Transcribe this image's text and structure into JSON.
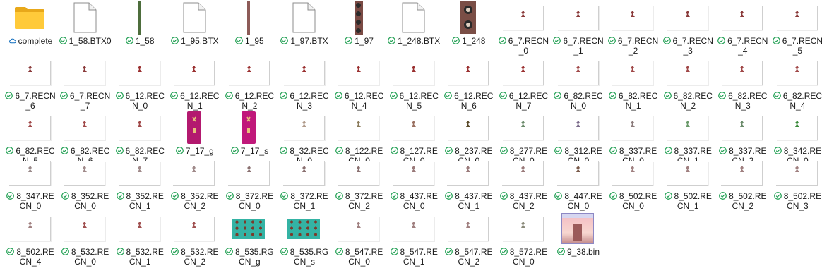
{
  "colors": {
    "sync_green": "#1d9e50",
    "cloud_blue": "#0f6cbd",
    "folder": "#ffca3a",
    "hover": "#e5f3ff"
  },
  "items": [
    {
      "label": "complete",
      "kind": "folder",
      "status": "cloud"
    },
    {
      "label": "1_58.BTX0",
      "kind": "doc",
      "status": "ok"
    },
    {
      "label": "1_58",
      "kind": "strip",
      "status": "ok",
      "color": "#4d6d3c"
    },
    {
      "label": "1_95.BTX",
      "kind": "doc",
      "status": "ok"
    },
    {
      "label": "1_95",
      "kind": "strip",
      "status": "ok",
      "color": "#8d5b58"
    },
    {
      "label": "1_97.BTX",
      "kind": "doc",
      "status": "ok"
    },
    {
      "label": "1_97",
      "kind": "stripwide",
      "status": "ok"
    },
    {
      "label": "1_248.BTX",
      "kind": "doc",
      "status": "ok"
    },
    {
      "label": "1_248",
      "kind": "portrait",
      "status": "ok"
    },
    {
      "label": "6_7.RECN_0",
      "kind": "sprite",
      "status": "ok",
      "color": "#8a3a3a"
    },
    {
      "label": "6_7.RECN_1",
      "kind": "sprite",
      "status": "ok",
      "color": "#8a3a3a"
    },
    {
      "label": "6_7.RECN_2",
      "kind": "sprite",
      "status": "ok",
      "color": "#8a3a3a"
    },
    {
      "label": "6_7.RECN_3",
      "kind": "sprite",
      "status": "ok",
      "color": "#8a3a3a"
    },
    {
      "label": "6_7.RECN_4",
      "kind": "sprite",
      "status": "ok",
      "color": "#8a3a3a"
    },
    {
      "label": "6_7.RECN_5",
      "kind": "sprite",
      "status": "ok",
      "color": "#8a3a3a"
    },
    {
      "label": "6_7.RECN_6",
      "kind": "sprite",
      "status": "ok",
      "color": "#8a3a3a"
    },
    {
      "label": "6_7.RECN_7",
      "kind": "sprite",
      "status": "ok",
      "color": "#8a3a3a"
    },
    {
      "label": "6_12.RECN_0",
      "kind": "sprite",
      "status": "ok",
      "color": "#9a3030"
    },
    {
      "label": "6_12.RECN_1",
      "kind": "sprite",
      "status": "ok",
      "color": "#9a3030"
    },
    {
      "label": "6_12.RECN_2",
      "kind": "sprite",
      "status": "ok",
      "color": "#9a3030"
    },
    {
      "label": "6_12.RECN_3",
      "kind": "sprite",
      "status": "ok",
      "color": "#9a3030"
    },
    {
      "label": "6_12.RECN_4",
      "kind": "sprite",
      "status": "ok",
      "color": "#9a3030"
    },
    {
      "label": "6_12.RECN_5",
      "kind": "sprite",
      "status": "ok",
      "color": "#9a3030"
    },
    {
      "label": "6_12.RECN_6",
      "kind": "sprite",
      "status": "ok",
      "color": "#9a3030"
    },
    {
      "label": "6_12.RECN_7",
      "kind": "sprite",
      "status": "ok",
      "color": "#9a3030"
    },
    {
      "label": "6_82.RECN_0",
      "kind": "sprite",
      "status": "ok",
      "color": "#a04848"
    },
    {
      "label": "6_82.RECN_1",
      "kind": "sprite",
      "status": "ok",
      "color": "#a04848"
    },
    {
      "label": "6_82.RECN_2",
      "kind": "sprite",
      "status": "ok",
      "color": "#a04848"
    },
    {
      "label": "6_82.RECN_3",
      "kind": "sprite",
      "status": "ok",
      "color": "#a04848"
    },
    {
      "label": "6_82.RECN_4",
      "kind": "sprite",
      "status": "ok",
      "color": "#a04848"
    },
    {
      "label": "6_82.RECN_5",
      "kind": "sprite",
      "status": "ok",
      "color": "#a04848"
    },
    {
      "label": "6_82.RECN_6",
      "kind": "sprite",
      "status": "ok",
      "color": "#a04848"
    },
    {
      "label": "6_82.RECN_7",
      "kind": "sprite",
      "status": "ok",
      "color": "#a04848"
    },
    {
      "label": "7_17_g",
      "kind": "tall",
      "status": "ok",
      "color": "#b3196f"
    },
    {
      "label": "7_17_s",
      "kind": "tall",
      "status": "ok",
      "color": "#c0187a"
    },
    {
      "label": "8_32.RECN_0",
      "kind": "sprite",
      "status": "ok",
      "color": "#b09a8a"
    },
    {
      "label": "8_122.RECN_0",
      "kind": "sprite",
      "status": "ok",
      "color": "#8a7a5a"
    },
    {
      "label": "8_127.RECN_0",
      "kind": "sprite",
      "status": "ok",
      "color": "#9a7060"
    },
    {
      "label": "8_237.RECN_0",
      "kind": "sprite",
      "status": "ok",
      "color": "#5a4a2a"
    },
    {
      "label": "8_277.RECN_0",
      "kind": "sprite",
      "status": "ok",
      "color": "#6a8a6a"
    },
    {
      "label": "8_312.RECN_0",
      "kind": "sprite",
      "status": "ok",
      "color": "#7a6a8a"
    },
    {
      "label": "8_337.RECN_0",
      "kind": "sprite",
      "status": "ok",
      "color": "#8a7a7a"
    },
    {
      "label": "8_337.RECN_1",
      "kind": "sprite",
      "status": "ok",
      "color": "#6a9a6a"
    },
    {
      "label": "8_337.RECN_2",
      "kind": "sprite",
      "status": "ok",
      "color": "#6a8a6a"
    },
    {
      "label": "8_342.RECN_0",
      "kind": "sprite",
      "status": "ok",
      "color": "#3a8a3a"
    },
    {
      "label": "8_347.RECN_0",
      "kind": "sprite",
      "status": "ok",
      "color": "#9a8a8a"
    },
    {
      "label": "8_352.RECN_0",
      "kind": "sprite",
      "status": "ok",
      "color": "#a08a8a"
    },
    {
      "label": "8_352.RECN_1",
      "kind": "sprite",
      "status": "ok",
      "color": "#a08a8a"
    },
    {
      "label": "8_352.RECN_2",
      "kind": "sprite",
      "status": "ok",
      "color": "#a08a8a"
    },
    {
      "label": "8_372.RECN_0",
      "kind": "sprite",
      "status": "ok",
      "color": "#8a7070"
    },
    {
      "label": "8_372.RECN_1",
      "kind": "sprite",
      "status": "ok",
      "color": "#8a7070"
    },
    {
      "label": "8_372.RECN_2",
      "kind": "sprite",
      "status": "ok",
      "color": "#8a7070"
    },
    {
      "label": "8_437.RECN_0",
      "kind": "sprite",
      "status": "ok",
      "color": "#9a7a7a"
    },
    {
      "label": "8_437.RECN_1",
      "kind": "sprite",
      "status": "ok",
      "color": "#9a7a7a"
    },
    {
      "label": "8_437.RECN_2",
      "kind": "sprite",
      "status": "ok",
      "color": "#9a7a7a"
    },
    {
      "label": "8_447.RECN_0",
      "kind": "sprite",
      "status": "ok",
      "color": "#7a5a4a"
    },
    {
      "label": "8_502.RECN_0",
      "kind": "sprite",
      "status": "ok",
      "color": "#a08080"
    },
    {
      "label": "8_502.RECN_1",
      "kind": "sprite",
      "status": "ok",
      "color": "#a08080"
    },
    {
      "label": "8_502.RECN_2",
      "kind": "sprite",
      "status": "ok",
      "color": "#a08080"
    },
    {
      "label": "8_502.RECN_3",
      "kind": "sprite",
      "status": "ok",
      "color": "#a08080"
    },
    {
      "label": "8_502.RECN_4",
      "kind": "sprite",
      "status": "ok",
      "color": "#a08080"
    },
    {
      "label": "8_532.RECN_0",
      "kind": "sprite",
      "status": "ok",
      "color": "#a05050"
    },
    {
      "label": "8_532.RECN_1",
      "kind": "sprite",
      "status": "ok",
      "color": "#a05050"
    },
    {
      "label": "8_532.RECN_2",
      "kind": "sprite",
      "status": "ok",
      "color": "#a05050"
    },
    {
      "label": "8_535.RGCN_g",
      "kind": "green",
      "status": "ok"
    },
    {
      "label": "8_535.RGCN_s",
      "kind": "green",
      "status": "ok"
    },
    {
      "label": "8_547.RECN_0",
      "kind": "sprite",
      "status": "ok",
      "color": "#a08080"
    },
    {
      "label": "8_547.RECN_1",
      "kind": "sprite",
      "status": "ok",
      "color": "#a08080"
    },
    {
      "label": "8_547.RECN_2",
      "kind": "sprite",
      "status": "ok",
      "color": "#a08080"
    },
    {
      "label": "8_572.RECN_0",
      "kind": "sprite",
      "status": "ok",
      "color": "#8a8a7a"
    },
    {
      "label": "9_38.bin",
      "kind": "bin",
      "status": "ok"
    }
  ]
}
